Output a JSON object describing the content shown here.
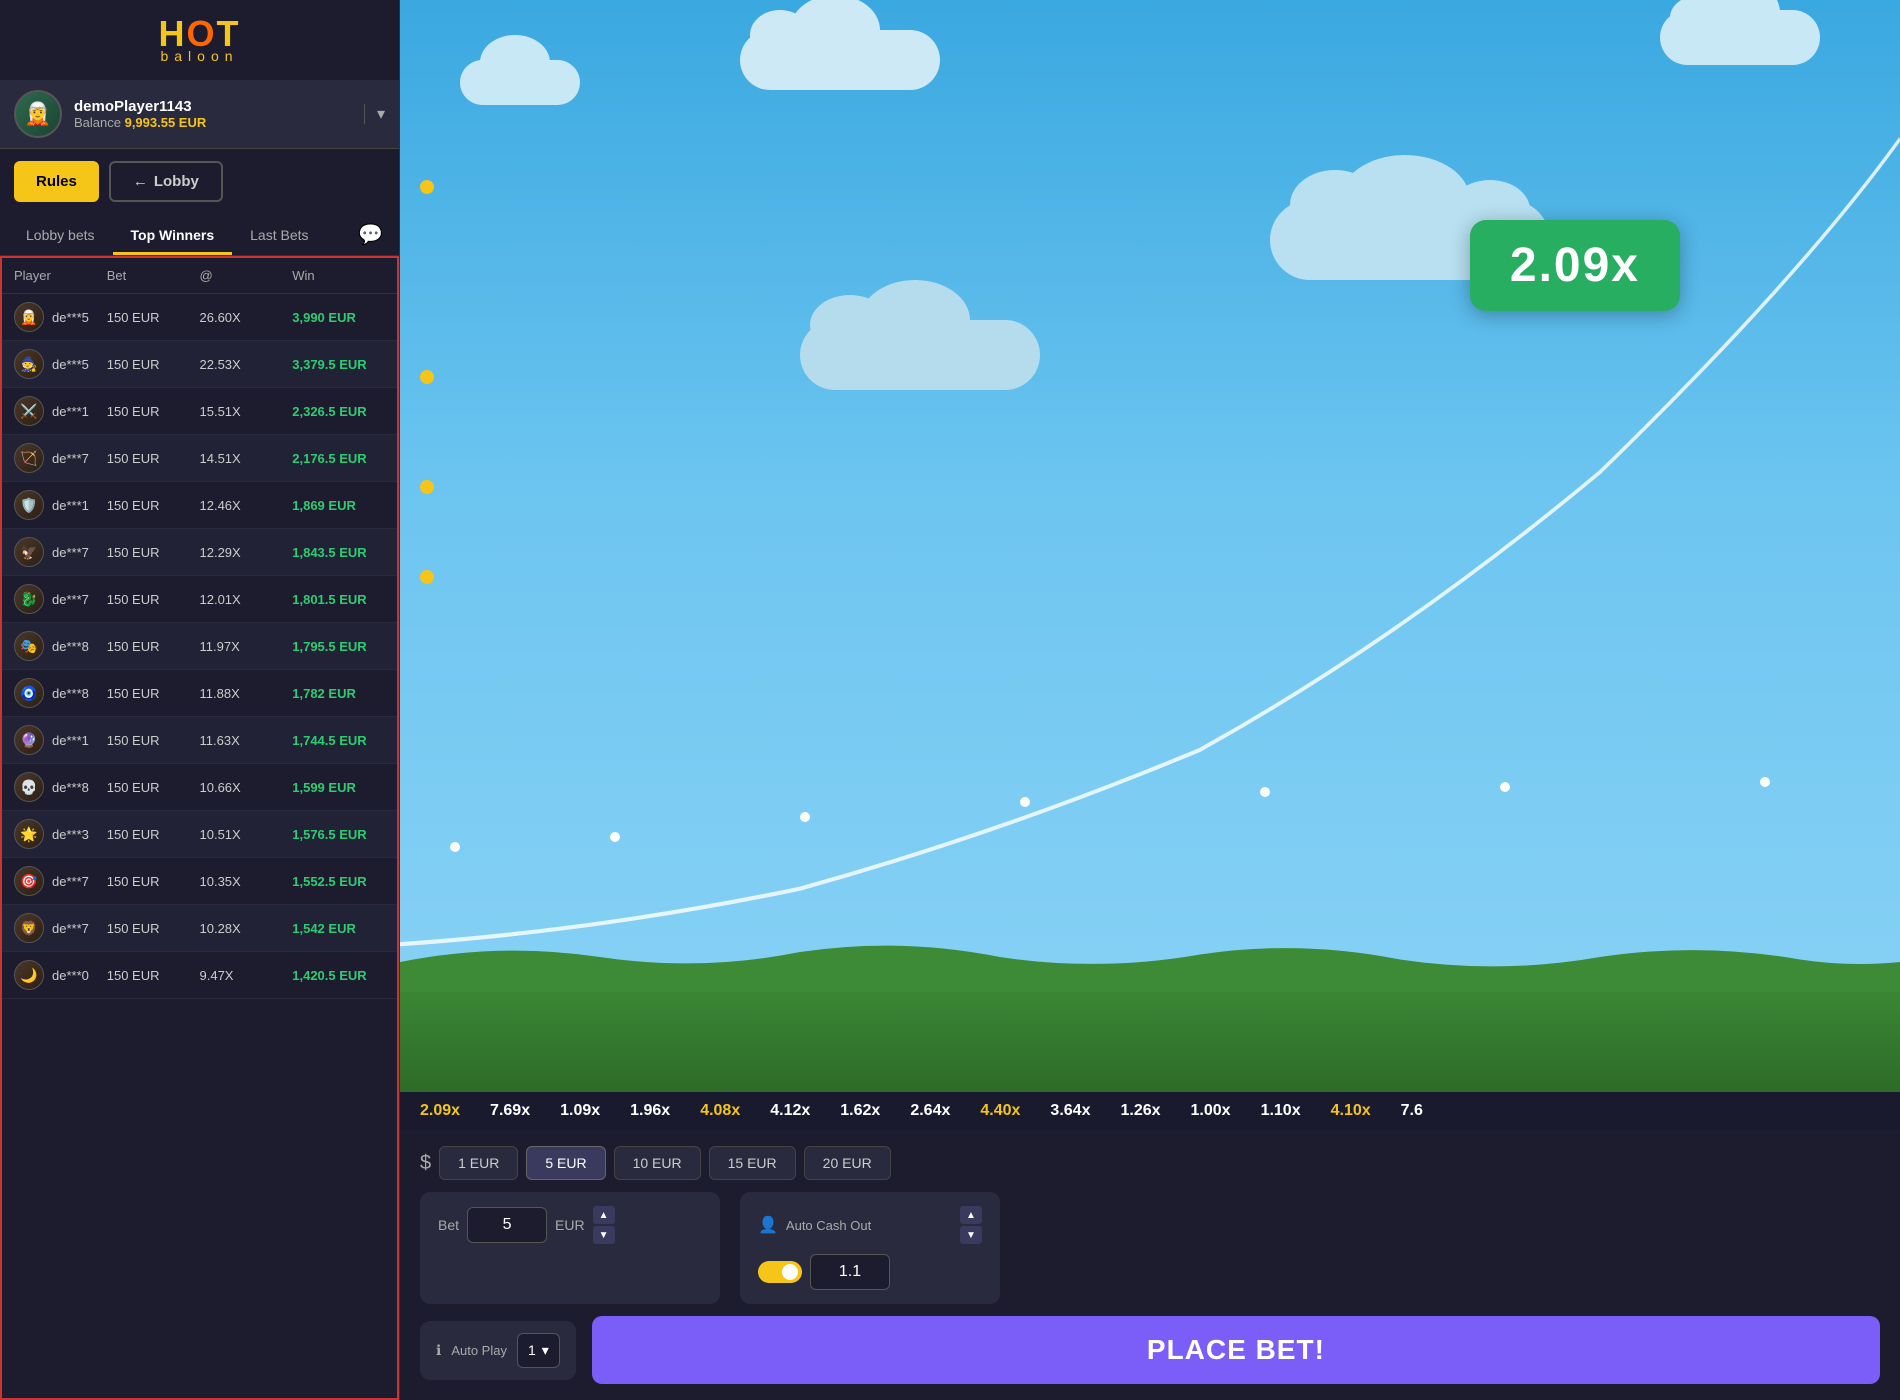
{
  "sidebar": {
    "logo": {
      "hot": "H",
      "o": "O",
      "t": "T",
      "sub": "baloon"
    },
    "profile": {
      "name": "demoPlayer1143",
      "balance_label": "Balance",
      "balance_value": "9,993.55 EUR"
    },
    "buttons": {
      "rules": "Rules",
      "lobby": "Lobby"
    },
    "tabs": [
      {
        "id": "lobby-bets",
        "label": "Lobby bets"
      },
      {
        "id": "top-winners",
        "label": "Top Winners"
      },
      {
        "id": "last-bets",
        "label": "Last Bets"
      }
    ],
    "table": {
      "headers": [
        "Player",
        "Bet",
        "@",
        "Win"
      ],
      "rows": [
        {
          "player": "de***5",
          "bet": "150 EUR",
          "mult": "26.60X",
          "win": "3,990 EUR"
        },
        {
          "player": "de***5",
          "bet": "150 EUR",
          "mult": "22.53X",
          "win": "3,379.5 EUR"
        },
        {
          "player": "de***1",
          "bet": "150 EUR",
          "mult": "15.51X",
          "win": "2,326.5 EUR"
        },
        {
          "player": "de***7",
          "bet": "150 EUR",
          "mult": "14.51X",
          "win": "2,176.5 EUR"
        },
        {
          "player": "de***1",
          "bet": "150 EUR",
          "mult": "12.46X",
          "win": "1,869 EUR"
        },
        {
          "player": "de***7",
          "bet": "150 EUR",
          "mult": "12.29X",
          "win": "1,843.5 EUR"
        },
        {
          "player": "de***7",
          "bet": "150 EUR",
          "mult": "12.01X",
          "win": "1,801.5 EUR"
        },
        {
          "player": "de***8",
          "bet": "150 EUR",
          "mult": "11.97X",
          "win": "1,795.5 EUR"
        },
        {
          "player": "de***8",
          "bet": "150 EUR",
          "mult": "11.88X",
          "win": "1,782 EUR"
        },
        {
          "player": "de***1",
          "bet": "150 EUR",
          "mult": "11.63X",
          "win": "1,744.5 EUR"
        },
        {
          "player": "de***8",
          "bet": "150 EUR",
          "mult": "10.66X",
          "win": "1,599 EUR"
        },
        {
          "player": "de***3",
          "bet": "150 EUR",
          "mult": "10.51X",
          "win": "1,576.5 EUR"
        },
        {
          "player": "de***7",
          "bet": "150 EUR",
          "mult": "10.35X",
          "win": "1,552.5 EUR"
        },
        {
          "player": "de***7",
          "bet": "150 EUR",
          "mult": "10.28X",
          "win": "1,542 EUR"
        },
        {
          "player": "de***0",
          "bet": "150 EUR",
          "mult": "9.47X",
          "win": "1,420.5 EUR"
        }
      ]
    }
  },
  "game": {
    "multiplier": "2.09x",
    "multiplier_color": "#27ae60"
  },
  "strip": {
    "values": [
      {
        "val": "2.09x",
        "color": "yellow"
      },
      {
        "val": "7.69x",
        "color": "white"
      },
      {
        "val": "1.09x",
        "color": "white"
      },
      {
        "val": "1.96x",
        "color": "white"
      },
      {
        "val": "4.08x",
        "color": "yellow"
      },
      {
        "val": "4.12x",
        "color": "white"
      },
      {
        "val": "1.62x",
        "color": "white"
      },
      {
        "val": "2.64x",
        "color": "white"
      },
      {
        "val": "4.40x",
        "color": "yellow"
      },
      {
        "val": "3.64x",
        "color": "white"
      },
      {
        "val": "1.26x",
        "color": "white"
      },
      {
        "val": "1.00x",
        "color": "white"
      },
      {
        "val": "1.10x",
        "color": "white"
      },
      {
        "val": "4.10x",
        "color": "yellow"
      },
      {
        "val": "7.6",
        "color": "white"
      }
    ]
  },
  "controls": {
    "presets": [
      "1 EUR",
      "5 EUR",
      "10 EUR",
      "15 EUR",
      "20 EUR"
    ],
    "bet": {
      "label": "Bet",
      "value": "5",
      "currency": "EUR"
    },
    "auto_cashout": {
      "title": "Auto Cash Out",
      "value": "1.1"
    },
    "auto_play": {
      "label": "Auto Play",
      "value": "1"
    },
    "place_bet": "PLACE BET!"
  }
}
